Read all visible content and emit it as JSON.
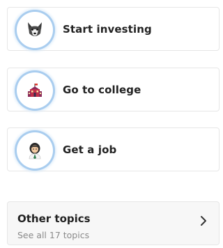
{
  "topics": [
    {
      "label": "Start investing",
      "icon": "wolf-icon"
    },
    {
      "label": "Go to college",
      "icon": "school-icon"
    },
    {
      "label": "Get a job",
      "icon": "worker-icon"
    }
  ],
  "other_topics": {
    "title": "Other topics",
    "subtitle": "See all 17 topics",
    "icon": "chevron-right-icon"
  },
  "colors": {
    "ring": "#a9cdef",
    "text": "#222222",
    "subtext": "#8a8a8a",
    "border": "#e6e6e6"
  }
}
